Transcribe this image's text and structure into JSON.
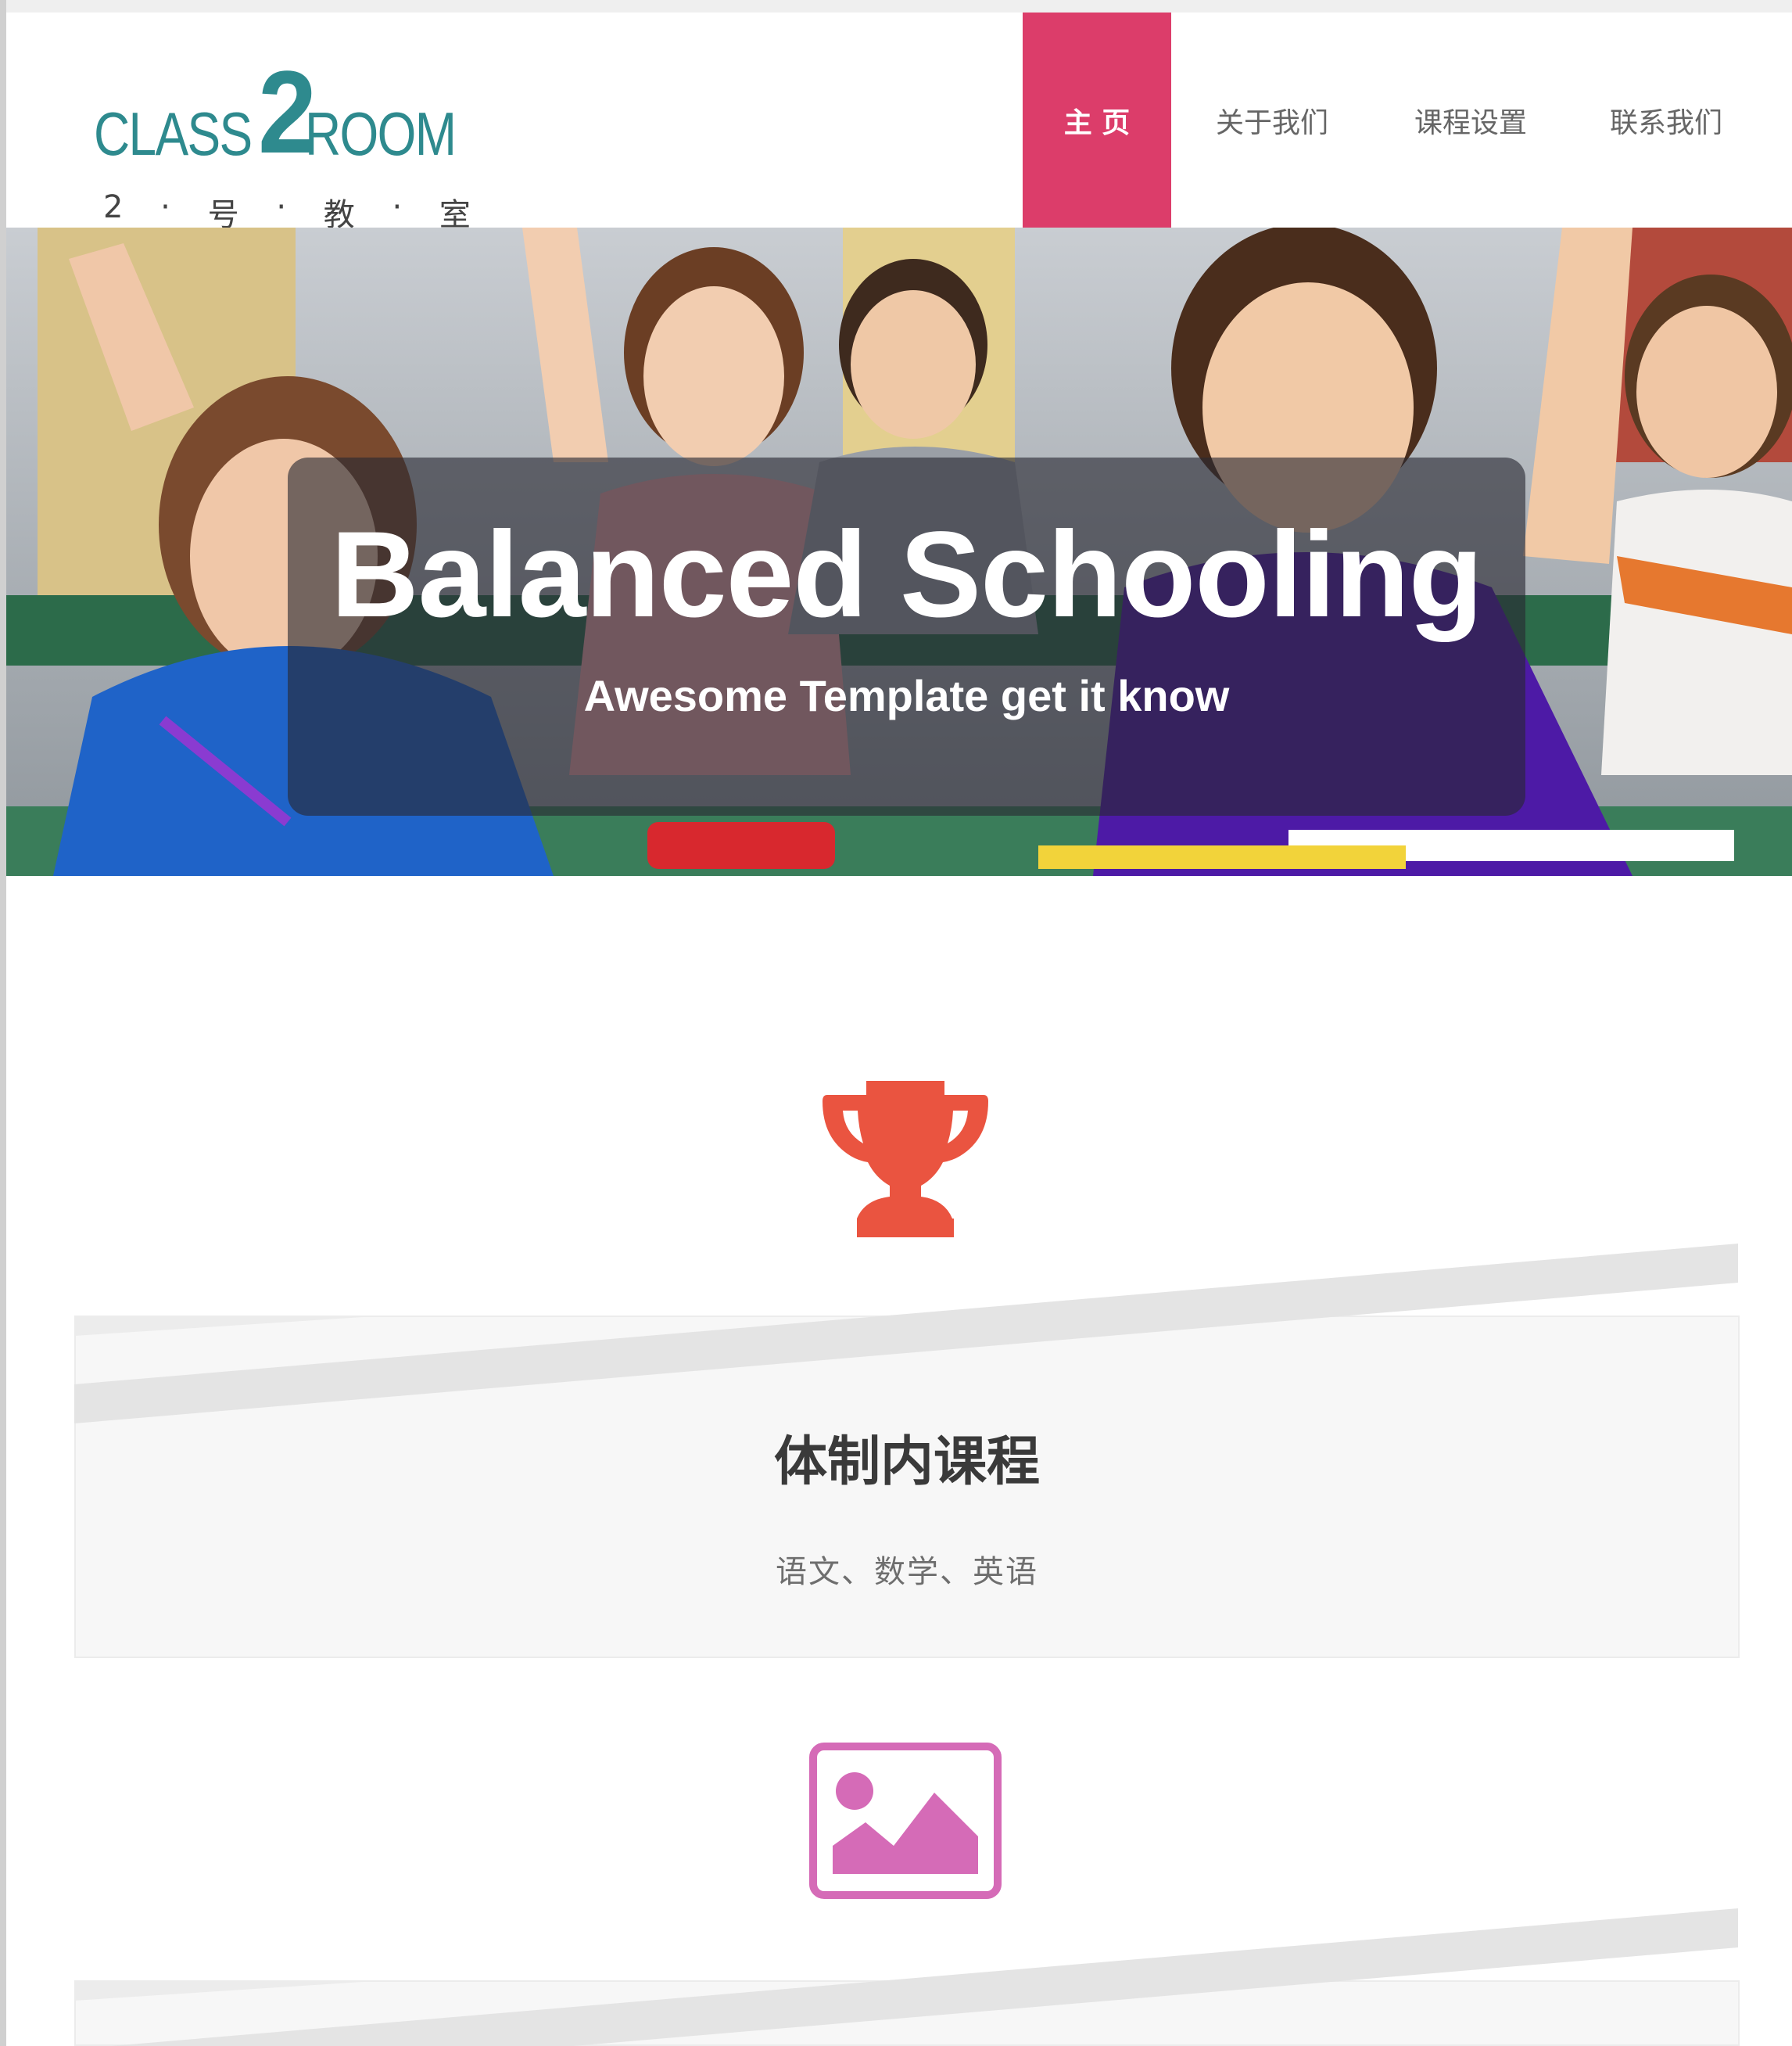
{
  "logo": {
    "word_left": "CLASS",
    "digit": "2",
    "word_right": "ROOM",
    "tagline_chars": [
      "2",
      "·",
      "号",
      "·",
      "教",
      "·",
      "室"
    ]
  },
  "nav": {
    "home": "主 页",
    "about": "关于我们",
    "courses": "课程设置",
    "contact": "联系我们"
  },
  "hero": {
    "title": "Balanced Schooling",
    "subtitle": "Awesome Template get it know"
  },
  "features": [
    {
      "icon": "trophy-icon",
      "title": "体制内课程",
      "text": "语文、数学、英语"
    },
    {
      "icon": "image-icon"
    }
  ],
  "colors": {
    "nav_active": "#dc3d6a",
    "logo": "#2e8a8e",
    "trophy_icon": "#ea5440",
    "image_icon": "#d56bb7"
  }
}
